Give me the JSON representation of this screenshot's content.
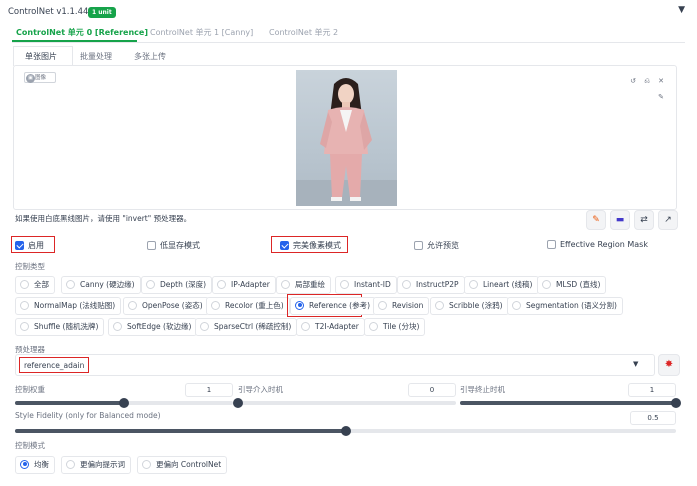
{
  "header": {
    "title": "ControlNet v1.1.449",
    "badge": "1 unit",
    "collapse_icon": "▼"
  },
  "unit_tabs": [
    {
      "label": "ControlNet 单元 0 [Reference]",
      "active": true
    },
    {
      "label": "ControlNet 单元 1 [Canny]",
      "active": false
    },
    {
      "label": "ControlNet 单元 2",
      "active": false
    }
  ],
  "image_tabs": [
    {
      "label": "单张图片",
      "active": true
    },
    {
      "label": "批量处理",
      "active": false
    },
    {
      "label": "多张上传",
      "active": false
    }
  ],
  "image_panel": {
    "label": "图像",
    "tools": [
      "↺",
      "⎌",
      "✕",
      "✎"
    ]
  },
  "hint": "如果使用白底黑线图片，请使用 \"invert\" 预处理器。",
  "action_buttons": [
    "✎",
    "▬",
    "⇄",
    "↗"
  ],
  "checkboxes": [
    {
      "label": "启用",
      "checked": true
    },
    {
      "label": "低显存模式",
      "checked": false
    },
    {
      "label": "完美像素模式",
      "checked": true
    },
    {
      "label": "允许预览",
      "checked": false
    },
    {
      "label": "Effective Region Mask",
      "checked": false
    }
  ],
  "control_type": {
    "label": "控制类型",
    "options": [
      {
        "label": "全部",
        "selected": false
      },
      {
        "label": "Canny (硬边缘)",
        "selected": false
      },
      {
        "label": "Depth (深度)",
        "selected": false
      },
      {
        "label": "IP-Adapter",
        "selected": false
      },
      {
        "label": "局部重绘",
        "selected": false
      },
      {
        "label": "Instant-ID",
        "selected": false
      },
      {
        "label": "InstructP2P",
        "selected": false
      },
      {
        "label": "Lineart (线稿)",
        "selected": false
      },
      {
        "label": "MLSD (直线)",
        "selected": false
      },
      {
        "label": "NormalMap (法线贴图)",
        "selected": false
      },
      {
        "label": "OpenPose (姿态)",
        "selected": false
      },
      {
        "label": "Recolor (重上色)",
        "selected": false
      },
      {
        "label": "Reference (参考)",
        "selected": true
      },
      {
        "label": "Revision",
        "selected": false
      },
      {
        "label": "Scribble (涂鸦)",
        "selected": false
      },
      {
        "label": "Segmentation (语义分割)",
        "selected": false
      },
      {
        "label": "Shuffle (随机洗牌)",
        "selected": false
      },
      {
        "label": "SoftEdge (软边缘)",
        "selected": false
      },
      {
        "label": "SparseCtrl (稀疏控制)",
        "selected": false
      },
      {
        "label": "T2I-Adapter",
        "selected": false
      },
      {
        "label": "Tile (分块)",
        "selected": false
      }
    ]
  },
  "preprocessor": {
    "label": "预处理器",
    "value": "reference_adain",
    "run_icon": "✸"
  },
  "sliders": {
    "weight": {
      "label": "控制权重",
      "value": "1",
      "fraction": 0.5
    },
    "start": {
      "label": "引导介入时机",
      "value": "0",
      "fraction": 0.0
    },
    "end": {
      "label": "引导终止时机",
      "value": "1",
      "fraction": 1.0
    },
    "fidelity": {
      "label": "Style Fidelity (only for Balanced mode)",
      "value": "0.5",
      "fraction": 0.5
    }
  },
  "control_mode": {
    "label": "控制模式",
    "options": [
      {
        "label": "均衡",
        "selected": true
      },
      {
        "label": "更偏向提示词",
        "selected": false
      },
      {
        "label": "更偏向 ControlNet",
        "selected": false
      }
    ]
  }
}
